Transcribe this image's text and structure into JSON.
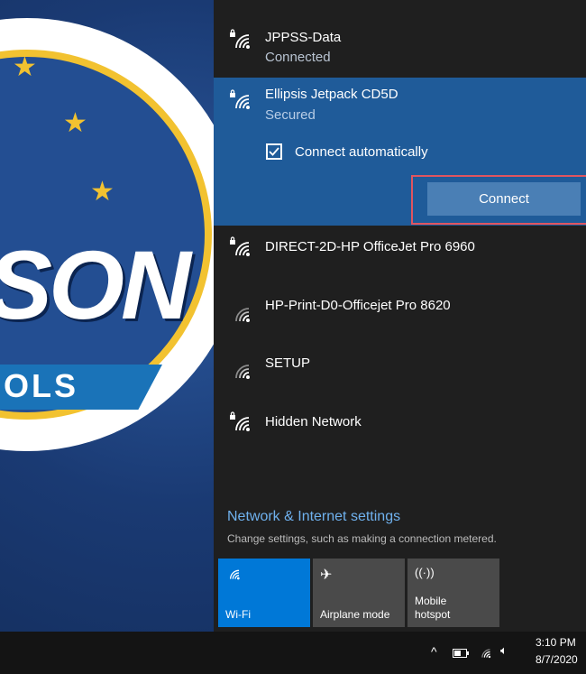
{
  "wallpaper": {
    "logo_text": "SON",
    "ribbon_text": "OLS"
  },
  "networks": [
    {
      "name": "JPPSS-Data",
      "status": "Connected",
      "secured": true,
      "icon": "wifi-secured-icon"
    },
    {
      "name": "Ellipsis Jetpack CD5D",
      "status": "Secured",
      "secured": true,
      "icon": "wifi-secured-icon",
      "expanded": true
    },
    {
      "name": "DIRECT-2D-HP OfficeJet Pro 6960",
      "secured": true,
      "icon": "wifi-secured-icon"
    },
    {
      "name": "HP-Print-D0-Officejet Pro 8620",
      "secured": false,
      "icon": "wifi-open-icon"
    },
    {
      "name": "SETUP",
      "secured": false,
      "icon": "wifi-open-icon"
    },
    {
      "name": "Hidden Network",
      "secured": true,
      "icon": "wifi-secured-icon"
    }
  ],
  "expanded_network": {
    "connect_automatically_label": "Connect automatically",
    "connect_automatically_checked": true,
    "connect_button_label": "Connect"
  },
  "settings": {
    "link_label": "Network & Internet settings",
    "description": "Change settings, such as making a connection metered."
  },
  "quick_actions": [
    {
      "label": "Wi-Fi",
      "icon": "wifi-icon",
      "active": true
    },
    {
      "label": "Airplane mode",
      "icon": "airplane-icon",
      "active": false
    },
    {
      "label_line1": "Mobile",
      "label_line2": "hotspot",
      "icon": "hotspot-icon",
      "active": false
    }
  ],
  "taskbar": {
    "time": "3:10 PM",
    "date": "8/7/2020",
    "tray_icons": [
      "chevron-up-icon",
      "battery-icon",
      "wifi-icon",
      "volume-icon"
    ]
  },
  "colors": {
    "flyout_bg": "#1f1f1f",
    "expanded_bg": "#1f5b99",
    "accent": "#0078d7",
    "link": "#6fb1ee",
    "highlight_border": "#e05560"
  }
}
